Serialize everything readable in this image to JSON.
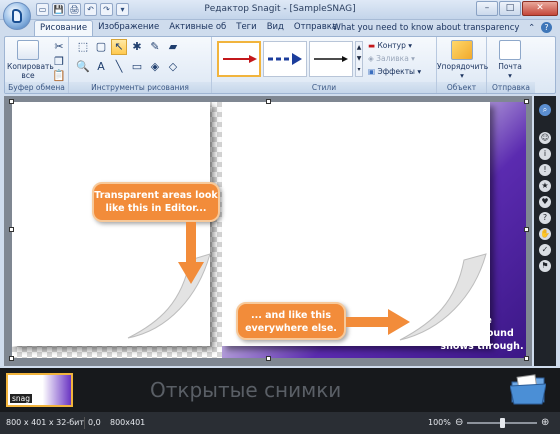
{
  "window": {
    "title": "Редактор Snagit - [SampleSNAG]"
  },
  "quick_access": [
    "▭",
    "💾",
    "🖨",
    "↶",
    "↷",
    "▾"
  ],
  "window_controls": {
    "minimize": "–",
    "maximize": "□",
    "close": "✕"
  },
  "tabs": [
    "Рисование",
    "Изображение",
    "Активные об",
    "Теги",
    "Вид",
    "Отправка"
  ],
  "help_link": "What you need to know about transparency",
  "ribbon": {
    "clipboard": {
      "copy_label": "Копировать все",
      "group_label": "Буфер обмена"
    },
    "drawing_tools": {
      "group_label": "Инструменты рисования"
    },
    "styles": {
      "group_label": "Стили",
      "outline": "Контур",
      "fill": "Заливка",
      "effects": "Эффекты"
    },
    "object": {
      "arrange": "Упорядочить",
      "group_label": "Объект"
    },
    "send": {
      "mail": "Почта",
      "group_label": "Отправка"
    }
  },
  "canvas": {
    "callout1": "Transparent areas look like this in Editor...",
    "callout2": "... and like this everywhere else.",
    "background_note": "The background shows through.",
    "accent_orange": "#f28c3a",
    "accent_purple": "#4a22a0"
  },
  "tray": {
    "label": "Открытые снимки",
    "thumb_badge": "snag"
  },
  "status": {
    "dimensions": "800 x 401 x 32-бит",
    "position": "0,0",
    "size": "800x401",
    "zoom": "100%",
    "zoom_level": 1.0
  }
}
